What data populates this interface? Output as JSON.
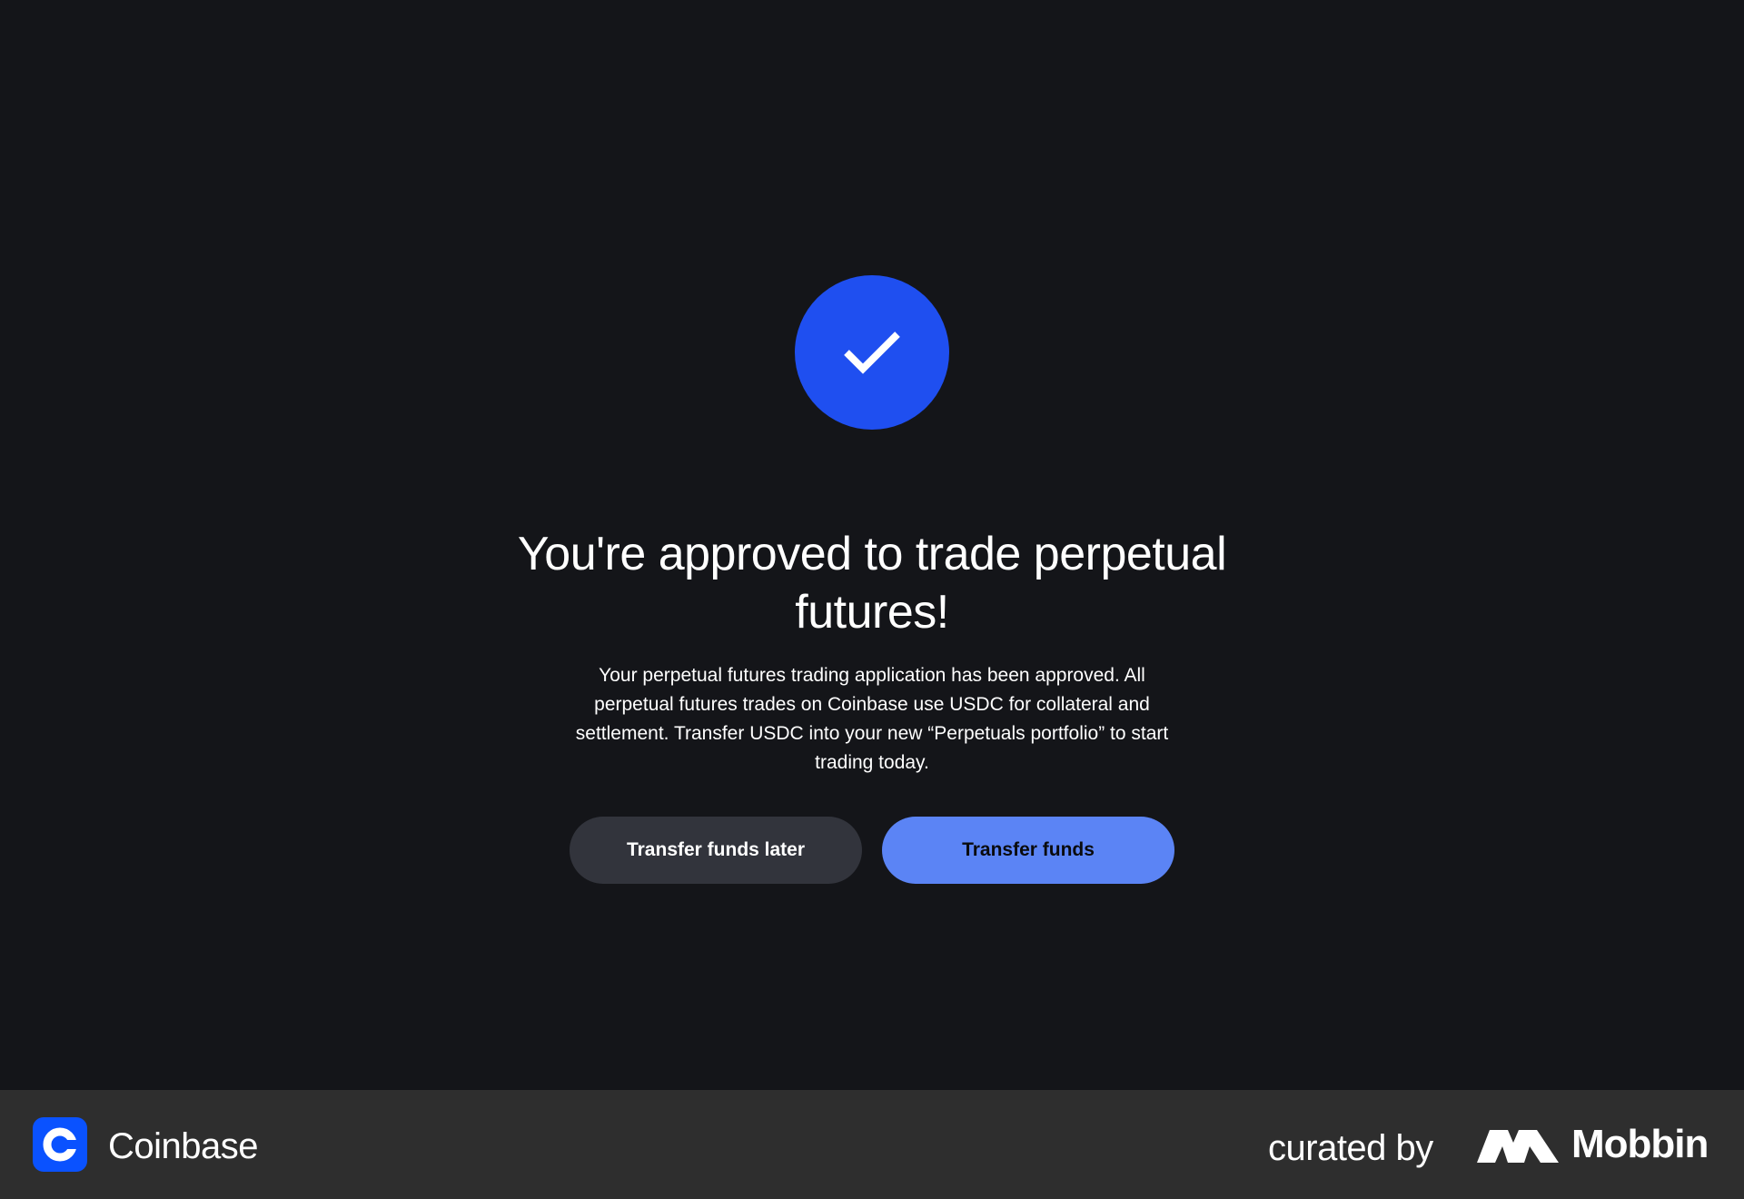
{
  "modal": {
    "icon": "check-icon",
    "title": "You're approved to trade perpetual futures!",
    "description": "Your perpetual futures trading application has been approved. All perpetual futures trades on Coinbase use USDC for collateral and settlement. Transfer USDC into your new “Perpetuals portfolio” to start trading today.",
    "secondary_button": "Transfer funds later",
    "primary_button": "Transfer funds"
  },
  "footer": {
    "app_icon": "coinbase-logo",
    "app_name": "Coinbase",
    "curated_label": "curated by",
    "brand_icon": "mobbin-logo",
    "brand_name": "Mobbin"
  },
  "colors": {
    "background": "#141519",
    "accent": "#1f4ff0",
    "primary_button": "#5b84f5",
    "secondary_button": "#32343c",
    "footer": "#2e2e2e",
    "coinbase_blue": "#0a52ff"
  }
}
